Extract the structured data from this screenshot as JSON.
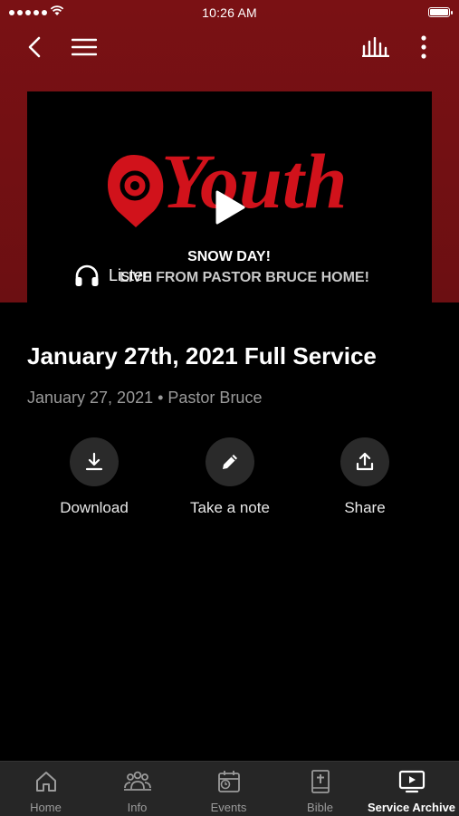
{
  "status_bar": {
    "time": "10:26 AM"
  },
  "media": {
    "logo_text": "Youth",
    "headline": "SNOW DAY!",
    "subline": "LIVE FROM PASTOR BRUCE HOME!",
    "listen_label": "Listen"
  },
  "sermon": {
    "title": "January 27th, 2021 Full Service",
    "meta": "January 27, 2021 • Pastor Bruce"
  },
  "actions": [
    {
      "label": "Download",
      "icon": "download-icon"
    },
    {
      "label": "Take a note",
      "icon": "pencil-icon"
    },
    {
      "label": "Share",
      "icon": "share-icon"
    }
  ],
  "tabs": [
    {
      "label": "Home",
      "icon": "home-icon"
    },
    {
      "label": "Info",
      "icon": "people-icon"
    },
    {
      "label": "Events",
      "icon": "calendar-icon"
    },
    {
      "label": "Bible",
      "icon": "bible-icon"
    },
    {
      "label": "Service Archive",
      "icon": "tv-play-icon",
      "active": true
    }
  ],
  "colors": {
    "header": "#7a1114",
    "accent_red": "#d1121b",
    "background": "#000000",
    "tabbar": "#262626"
  }
}
